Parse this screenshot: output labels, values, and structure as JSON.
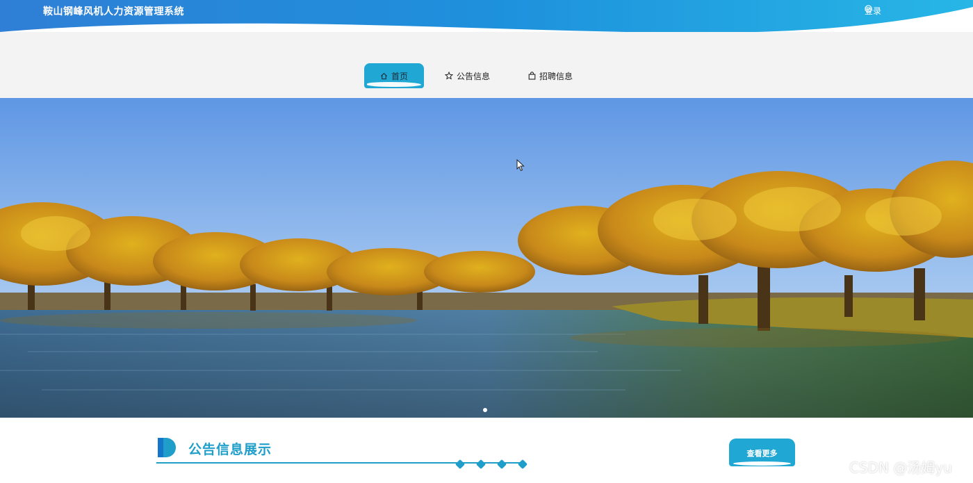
{
  "header": {
    "site_title": "鞍山钢峰风机人力资源管理系统",
    "login_label": "登录",
    "login_icon": "check-circle-icon"
  },
  "nav": {
    "items": [
      {
        "label": "首页",
        "icon": "home-icon",
        "active": true
      },
      {
        "label": "公告信息",
        "icon": "star-icon",
        "active": false
      },
      {
        "label": "招聘信息",
        "icon": "bag-icon",
        "active": false
      }
    ]
  },
  "banner": {
    "slide_count": 1,
    "active_slide": 1
  },
  "section": {
    "title": "公告信息展示",
    "more_label": "查看更多"
  },
  "watermark": "CSDN @汤姆yu",
  "colors": {
    "accent": "#21a7d3",
    "header_blue": "#1f86d8",
    "nav_band": "#f3f3f3"
  }
}
